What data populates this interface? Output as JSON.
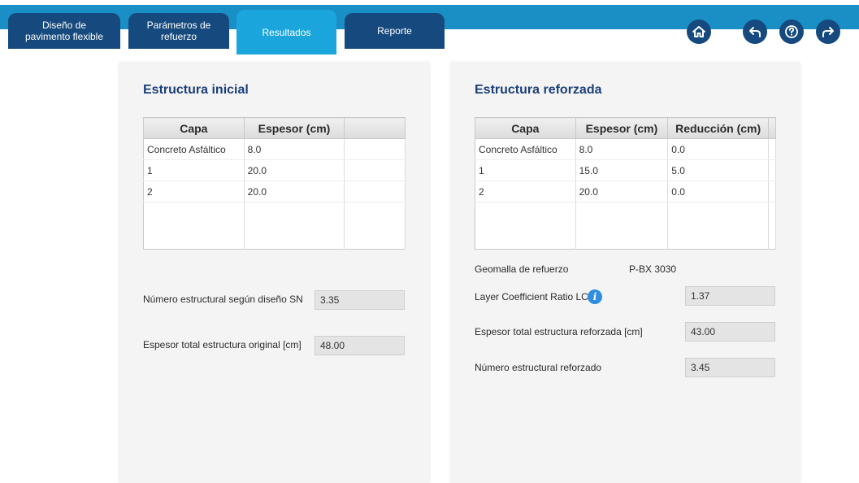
{
  "tabs": [
    {
      "label_1": "Diseño de",
      "label_2": "pavimento flexible"
    },
    {
      "label_1": "Parámetros de",
      "label_2": "refuerzo"
    },
    {
      "label_1": "Resultados"
    },
    {
      "label_1": "Reporte"
    }
  ],
  "colors": {
    "topbar": "#1a8fc6",
    "tab": "#164a7e",
    "tab_active": "#1aa6dc",
    "title": "#1b3f78"
  },
  "nav_icons": [
    "home-icon",
    "back-arrow-icon",
    "help-icon",
    "forward-arrow-icon"
  ],
  "initial": {
    "title": "Estructura inicial",
    "headers": [
      "Capa",
      "Espesor (cm)",
      ""
    ],
    "rows": [
      [
        "Concreto Asfáltico",
        "8.0"
      ],
      [
        "1",
        "20.0"
      ],
      [
        "2",
        "20.0"
      ]
    ],
    "sn_label": "Número estructural según diseño SN",
    "sn_value": "3.35",
    "thickness_label": "Espesor total estructura original [cm]",
    "thickness_value": "48.00"
  },
  "reinforced": {
    "title": "Estructura reforzada",
    "headers": [
      "Capa",
      "Espesor (cm)",
      "Reducción (cm)"
    ],
    "rows": [
      [
        "Concreto Asfáltico",
        "8.0",
        "0.0"
      ],
      [
        "1",
        "15.0",
        "5.0"
      ],
      [
        "2",
        "20.0",
        "0.0"
      ]
    ],
    "geogrid_label": "Geomalla de refuerzo",
    "geogrid_value": "P-BX 3030",
    "lcr_label": "Layer Coefficient Ratio LCR",
    "lcr_value": "1.37",
    "thickness_label": "Espesor total estructura reforzada [cm]",
    "thickness_value": "43.00",
    "sn_label": "Número estructural reforzado",
    "sn_value": "3.45"
  }
}
